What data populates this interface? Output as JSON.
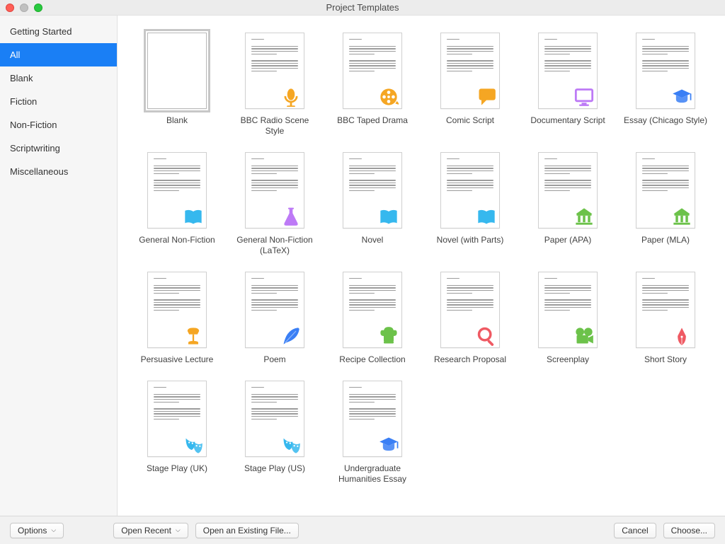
{
  "window": {
    "title": "Project Templates"
  },
  "sidebar": {
    "items": [
      {
        "label": "Getting Started"
      },
      {
        "label": "All"
      },
      {
        "label": "Blank"
      },
      {
        "label": "Fiction"
      },
      {
        "label": "Non-Fiction"
      },
      {
        "label": "Scriptwriting"
      },
      {
        "label": "Miscellaneous"
      }
    ],
    "selected_index": 1
  },
  "templates": [
    {
      "label": "Blank",
      "icon": "blank"
    },
    {
      "label": "BBC Radio Scene Style",
      "icon": "microphone",
      "color": "#f5a623"
    },
    {
      "label": "BBC Taped Drama",
      "icon": "film-reel",
      "color": "#f5a623"
    },
    {
      "label": "Comic Script",
      "icon": "speech-bubble",
      "color": "#f5a623"
    },
    {
      "label": "Documentary Script",
      "icon": "monitor",
      "color": "#bd7af6"
    },
    {
      "label": "Essay (Chicago Style)",
      "icon": "graduation-cap",
      "color": "#3a7ff5"
    },
    {
      "label": "General Non-Fiction",
      "icon": "open-book",
      "color": "#36b8ee"
    },
    {
      "label": "General Non-Fiction (LaTeX)",
      "icon": "flask",
      "color": "#bd7af6"
    },
    {
      "label": "Novel",
      "icon": "open-book",
      "color": "#36b8ee"
    },
    {
      "label": "Novel (with Parts)",
      "icon": "open-book",
      "color": "#36b8ee"
    },
    {
      "label": "Paper (APA)",
      "icon": "institution",
      "color": "#6cc24a"
    },
    {
      "label": "Paper (MLA)",
      "icon": "institution",
      "color": "#6cc24a"
    },
    {
      "label": "Persuasive Lecture",
      "icon": "desk-lamp",
      "color": "#f5a623"
    },
    {
      "label": "Poem",
      "icon": "feather",
      "color": "#3a7ff5"
    },
    {
      "label": "Recipe Collection",
      "icon": "chef-hat",
      "color": "#6cc24a"
    },
    {
      "label": "Research Proposal",
      "icon": "magnifier",
      "color": "#ef5a63"
    },
    {
      "label": "Screenplay",
      "icon": "video-camera",
      "color": "#6cc24a"
    },
    {
      "label": "Short Story",
      "icon": "fountain-pen",
      "color": "#ef5a63"
    },
    {
      "label": "Stage Play (UK)",
      "icon": "drama-masks",
      "color": "#36b8ee"
    },
    {
      "label": "Stage Play (US)",
      "icon": "drama-masks",
      "color": "#36b8ee"
    },
    {
      "label": "Undergraduate Humanities Essay",
      "icon": "graduation-cap",
      "color": "#3a7ff5"
    }
  ],
  "selected_template_index": 0,
  "footer": {
    "options": "Options",
    "open_recent": "Open Recent",
    "open_existing": "Open an Existing File...",
    "cancel": "Cancel",
    "choose": "Choose..."
  }
}
